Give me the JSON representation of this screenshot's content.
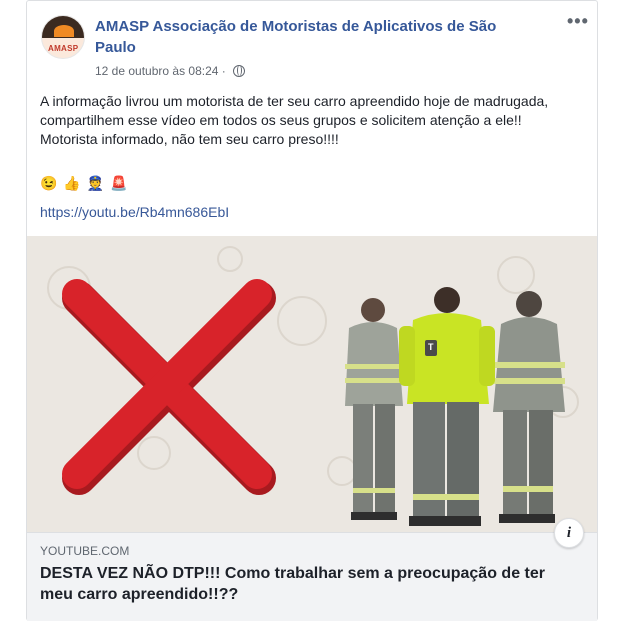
{
  "post": {
    "page_name": "AMASP Associação de Motoristas de Aplicativos de São Paulo",
    "avatar_text": "AMASP",
    "timestamp": "12 de outubro às 08:24 ·",
    "menu_label": "•••",
    "text_lines": [
      "A informação livrou um motorista de ter seu carro apreendido hoje de madrugada, compartilhem esse vídeo em todos os seus grupos e solicitem atenção a ele!!",
      "Motorista informado, não tem seu carro preso!!!!"
    ],
    "emojis": [
      "😉",
      "👍",
      "👮",
      "🚨"
    ],
    "link_url": "https://youtu.be/Rb4mn686EbI"
  },
  "preview": {
    "worker_logo_text": "T",
    "info_label": "i",
    "domain": "YOUTUBE.COM",
    "title": "DESTA VEZ NÃO DTP!!! Como trabalhar sem a preocupação de ter meu carro apreendido!!??"
  },
  "colors": {
    "link": "#365899",
    "cross": "#d8232a",
    "vest_yellow": "#c9e424",
    "uniform_gray": "#7b7f7a"
  }
}
